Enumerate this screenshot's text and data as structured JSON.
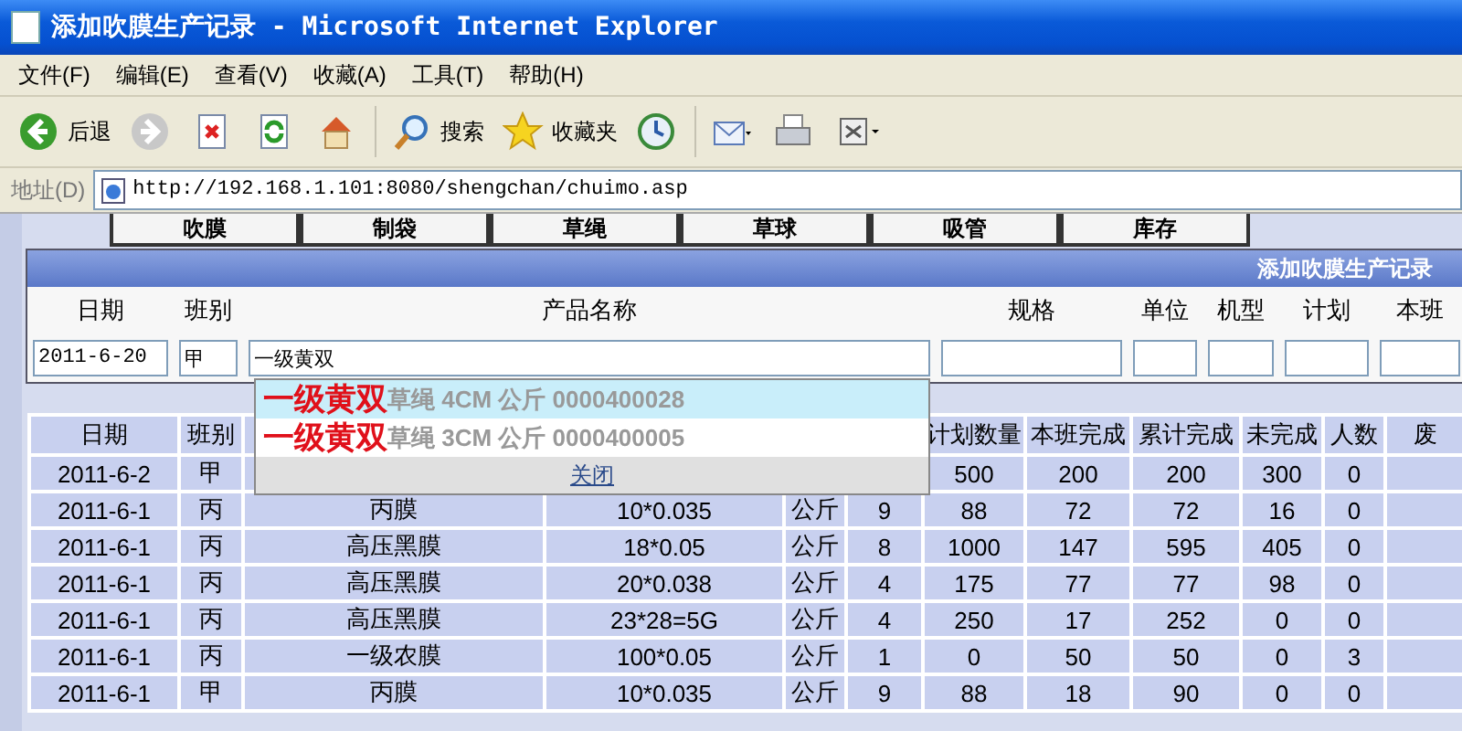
{
  "window": {
    "title": "添加吹膜生产记录 - Microsoft Internet Explorer"
  },
  "menu": [
    "文件(F)",
    "编辑(E)",
    "查看(V)",
    "收藏(A)",
    "工具(T)",
    "帮助(H)"
  ],
  "toolbar": [
    {
      "kind": "back",
      "label": "后退"
    },
    {
      "kind": "forward"
    },
    {
      "kind": "stop"
    },
    {
      "kind": "refresh"
    },
    {
      "kind": "home"
    },
    {
      "kind": "search",
      "label": "搜索"
    },
    {
      "kind": "favorites",
      "label": "收藏夹"
    },
    {
      "kind": "history"
    },
    {
      "kind": "mail"
    },
    {
      "kind": "print"
    },
    {
      "kind": "edit"
    }
  ],
  "address": {
    "label": "地址(D)",
    "url": "http://192.168.1.101:8080/shengchan/chuimo.asp"
  },
  "nav": [
    "吹膜",
    "制袋",
    "草绳",
    "草球",
    "吸管",
    "库存"
  ],
  "form": {
    "title": "添加吹膜生产记录",
    "fields": [
      {
        "label": "日期",
        "value": "2011-6-20"
      },
      {
        "label": "班别",
        "value": "甲"
      },
      {
        "label": "产品名称",
        "value": "一级黄双"
      },
      {
        "label": "规格"
      },
      {
        "label": "单位"
      },
      {
        "label": "机型"
      },
      {
        "label": "计划"
      },
      {
        "label": "本班"
      }
    ]
  },
  "suggestions": {
    "items": [
      {
        "match": "一级黄双",
        "detail": "草绳 4CM 公斤 0000400028",
        "selected": true
      },
      {
        "match": "一级黄双",
        "detail": "草绳 3CM 公斤 0000400005",
        "selected": false
      }
    ],
    "close": "关闭"
  },
  "table": {
    "columns": [
      "日期",
      "班别",
      "",
      "",
      "",
      "",
      "计划数量",
      "本班完成",
      "累计完成",
      "未完成",
      "人数",
      "废"
    ],
    "rows": [
      [
        "2011-6-2",
        "甲",
        "",
        "",
        "",
        "",
        "500",
        "200",
        "200",
        "300",
        "0",
        ""
      ],
      [
        "2011-6-1",
        "丙",
        "丙膜",
        "10*0.035",
        "公斤",
        "9",
        "88",
        "72",
        "72",
        "16",
        "0",
        ""
      ],
      [
        "2011-6-1",
        "丙",
        "高压黑膜",
        "18*0.05",
        "公斤",
        "8",
        "1000",
        "147",
        "595",
        "405",
        "0",
        ""
      ],
      [
        "2011-6-1",
        "丙",
        "高压黑膜",
        "20*0.038",
        "公斤",
        "4",
        "175",
        "77",
        "77",
        "98",
        "0",
        ""
      ],
      [
        "2011-6-1",
        "丙",
        "高压黑膜",
        "23*28=5G",
        "公斤",
        "4",
        "250",
        "17",
        "252",
        "0",
        "0",
        ""
      ],
      [
        "2011-6-1",
        "丙",
        "一级农膜",
        "100*0.05",
        "公斤",
        "1",
        "0",
        "50",
        "50",
        "0",
        "3",
        ""
      ],
      [
        "2011-6-1",
        "甲",
        "丙膜",
        "10*0.035",
        "公斤",
        "9",
        "88",
        "18",
        "90",
        "0",
        "0",
        ""
      ]
    ]
  }
}
